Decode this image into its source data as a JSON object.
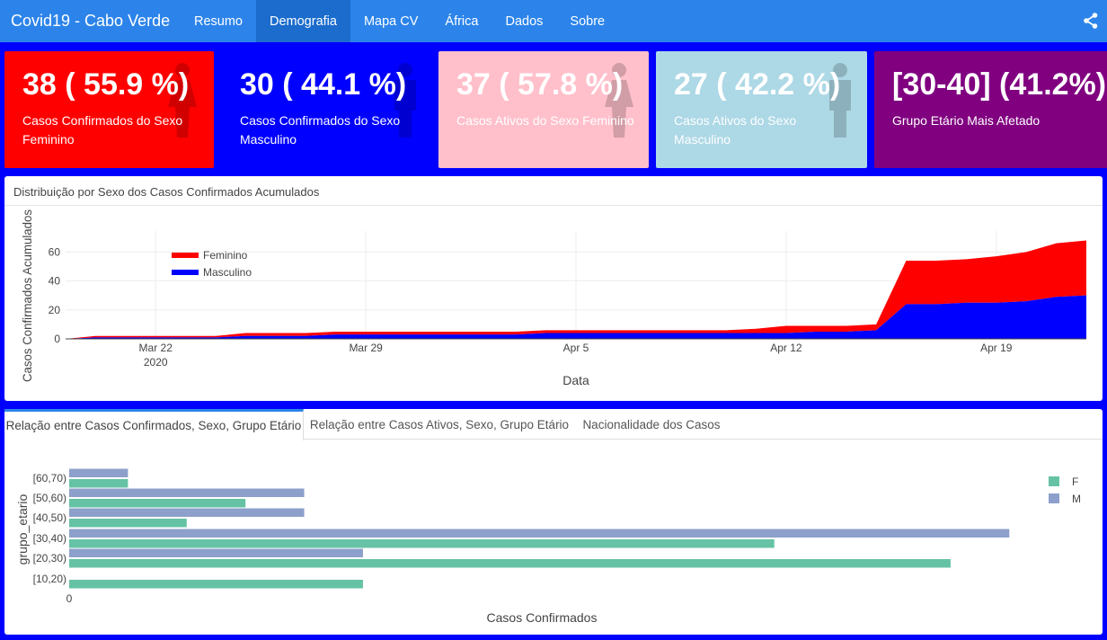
{
  "navbar": {
    "brand": "Covid19 - Cabo Verde",
    "items": [
      {
        "label": "Resumo",
        "active": false
      },
      {
        "label": "Demografia",
        "active": true
      },
      {
        "label": "Mapa CV",
        "active": false
      },
      {
        "label": "África",
        "active": false
      },
      {
        "label": "Dados",
        "active": false
      },
      {
        "label": "Sobre",
        "active": false
      }
    ],
    "share_icon": "share-icon"
  },
  "value_boxes": [
    {
      "value": "38 ( 55.9 %)",
      "caption": "Casos Confirmados do Sexo Feminino",
      "bg": "#ff0000",
      "fg": "#ffffff",
      "icon": "female-icon"
    },
    {
      "value": "30 ( 44.1 %)",
      "caption": "Casos Confirmados do Sexo Masculino",
      "bg": "#0000ff",
      "fg": "#ffffff",
      "icon": "male-icon"
    },
    {
      "value": "37 ( 57.8 %)",
      "caption": "Casos Ativos do Sexo Feminino",
      "bg": "#ffc0cb",
      "fg": "#ffffff",
      "icon": "female-icon"
    },
    {
      "value": "27 ( 42.2 %)",
      "caption": "Casos Ativos do Sexo Masculino",
      "bg": "#add8e6",
      "fg": "#ffffff",
      "icon": "male-icon"
    },
    {
      "value": "[30-40] (41.2%)",
      "caption": "Grupo Etário Mais Afetado",
      "bg": "#800080",
      "fg": "#ffffff",
      "icon": ""
    }
  ],
  "area_card": {
    "title": "Distribuição por Sexo dos Casos Confirmados Acumulados"
  },
  "bottom_card": {
    "tabs": [
      {
        "label": "Relação entre Casos Confirmados, Sexo, Grupo Etário",
        "active": true
      },
      {
        "label": "Relação entre Casos Ativos, Sexo, Grupo Etário",
        "active": false
      },
      {
        "label": "Nacionalidade dos Casos",
        "active": false
      }
    ]
  },
  "chart_data": [
    {
      "type": "area",
      "xlabel": "Data",
      "ylabel": "Casos Confirmados Acumulados",
      "x": [
        "2020-03-19",
        "2020-03-20",
        "2020-03-21",
        "2020-03-22",
        "2020-03-23",
        "2020-03-24",
        "2020-03-25",
        "2020-03-26",
        "2020-03-27",
        "2020-03-28",
        "2020-03-29",
        "2020-03-30",
        "2020-03-31",
        "2020-04-01",
        "2020-04-02",
        "2020-04-03",
        "2020-04-04",
        "2020-04-05",
        "2020-04-06",
        "2020-04-07",
        "2020-04-08",
        "2020-04-09",
        "2020-04-10",
        "2020-04-11",
        "2020-04-12",
        "2020-04-13",
        "2020-04-14",
        "2020-04-15",
        "2020-04-16",
        "2020-04-17",
        "2020-04-18",
        "2020-04-19",
        "2020-04-20",
        "2020-04-21",
        "2020-04-22"
      ],
      "x_ticks": [
        {
          "date": "2020-03-22",
          "label": "Mar 22",
          "sublabel": "2020"
        },
        {
          "date": "2020-03-29",
          "label": "Mar 29",
          "sublabel": ""
        },
        {
          "date": "2020-04-05",
          "label": "Apr 5",
          "sublabel": ""
        },
        {
          "date": "2020-04-12",
          "label": "Apr 12",
          "sublabel": ""
        },
        {
          "date": "2020-04-19",
          "label": "Apr 19",
          "sublabel": ""
        }
      ],
      "ylim": [
        0,
        72
      ],
      "y_ticks": [
        0,
        20,
        40,
        60
      ],
      "grid": true,
      "legend_position": "top-left",
      "series": [
        {
          "name": "Masculino",
          "color": "#0000ff",
          "values": [
            0,
            1,
            1,
            1,
            1,
            1,
            2,
            2,
            2,
            3,
            3,
            3,
            3,
            3,
            3,
            3,
            4,
            4,
            4,
            4,
            4,
            4,
            4,
            4,
            4,
            5,
            5,
            6,
            24,
            24,
            25,
            25,
            26,
            29,
            30
          ]
        },
        {
          "name": "Feminino",
          "color": "#ff0000",
          "values": [
            0,
            1,
            1,
            1,
            1,
            1,
            2,
            2,
            2,
            2,
            2,
            2,
            2,
            2,
            2,
            2,
            2,
            2,
            2,
            2,
            2,
            2,
            2,
            3,
            5,
            4,
            4,
            4,
            30,
            30,
            30,
            32,
            34,
            37,
            38
          ]
        }
      ]
    },
    {
      "type": "bar",
      "orientation": "horizontal",
      "xlabel": "Casos Confirmados",
      "ylabel": "grupo_etario",
      "categories": [
        "[10,20)",
        "[20,30)",
        "[30,40)",
        "[40,50)",
        "[50,60)",
        "[60,70)"
      ],
      "x_ticks": [
        0
      ],
      "xlim": [
        0,
        16.5
      ],
      "legend_position": "top-right",
      "series": [
        {
          "name": "F",
          "color": "#66c2a5",
          "values": [
            5,
            15,
            12,
            2,
            3,
            1
          ]
        },
        {
          "name": "M",
          "color": "#8da0cb",
          "values": [
            0,
            5,
            16,
            4,
            4,
            1
          ]
        }
      ]
    }
  ]
}
